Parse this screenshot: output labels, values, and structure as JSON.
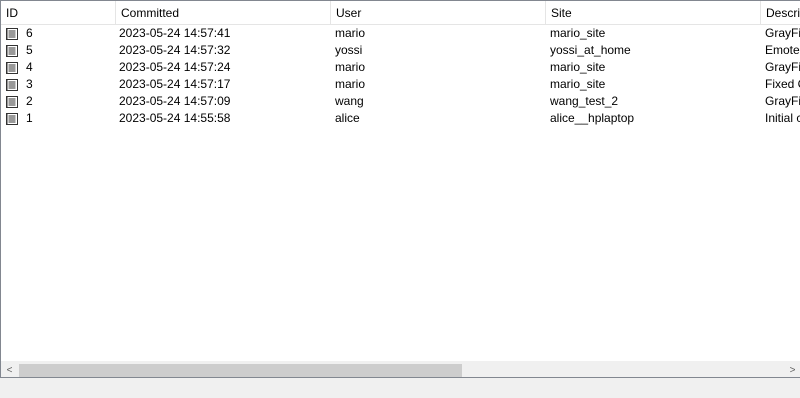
{
  "columns": {
    "id": "ID",
    "committed": "Committed",
    "user": "User",
    "site": "Site",
    "description": "Descri"
  },
  "rows": [
    {
      "id": "6",
      "committed": "2023-05-24 14:57:41",
      "user": "mario",
      "site": "mario_site",
      "description": "GrayFis"
    },
    {
      "id": "5",
      "committed": "2023-05-24 14:57:32",
      "user": "yossi",
      "site": "yossi_at_home",
      "description": "Emote"
    },
    {
      "id": "4",
      "committed": "2023-05-24 14:57:24",
      "user": "mario",
      "site": "mario_site",
      "description": "GrayFis"
    },
    {
      "id": "3",
      "committed": "2023-05-24 14:57:17",
      "user": "mario",
      "site": "mario_site",
      "description": "Fixed C"
    },
    {
      "id": "2",
      "committed": "2023-05-24 14:57:09",
      "user": "wang",
      "site": "wang_test_2",
      "description": "GrayFis"
    },
    {
      "id": "1",
      "committed": "2023-05-24 14:55:58",
      "user": "alice",
      "site": "alice__hplaptop",
      "description": "Initial c"
    }
  ],
  "row_icon": "changeset-document-icon",
  "scrollbar": {
    "left_arrow": "<",
    "right_arrow": ">"
  }
}
